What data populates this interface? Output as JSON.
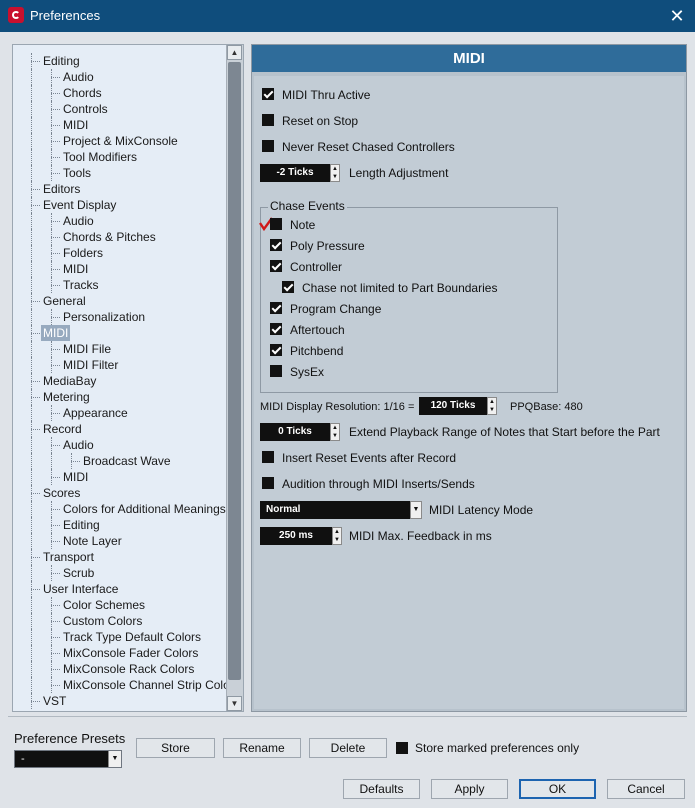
{
  "window": {
    "title": "Preferences",
    "close_glyph": "✕"
  },
  "tree": {
    "items": [
      {
        "label": "Editing",
        "level": 0
      },
      {
        "label": "Audio",
        "level": 1
      },
      {
        "label": "Chords",
        "level": 1
      },
      {
        "label": "Controls",
        "level": 1
      },
      {
        "label": "MIDI",
        "level": 1
      },
      {
        "label": "Project & MixConsole",
        "level": 1
      },
      {
        "label": "Tool Modifiers",
        "level": 1
      },
      {
        "label": "Tools",
        "level": 1
      },
      {
        "label": "Editors",
        "level": 0
      },
      {
        "label": "Event Display",
        "level": 0
      },
      {
        "label": "Audio",
        "level": 1
      },
      {
        "label": "Chords & Pitches",
        "level": 1
      },
      {
        "label": "Folders",
        "level": 1
      },
      {
        "label": "MIDI",
        "level": 1
      },
      {
        "label": "Tracks",
        "level": 1
      },
      {
        "label": "General",
        "level": 0
      },
      {
        "label": "Personalization",
        "level": 1
      },
      {
        "label": "MIDI",
        "level": 0,
        "selected": true
      },
      {
        "label": "MIDI File",
        "level": 1
      },
      {
        "label": "MIDI Filter",
        "level": 1
      },
      {
        "label": "MediaBay",
        "level": 0
      },
      {
        "label": "Metering",
        "level": 0
      },
      {
        "label": "Appearance",
        "level": 1
      },
      {
        "label": "Record",
        "level": 0
      },
      {
        "label": "Audio",
        "level": 1
      },
      {
        "label": "Broadcast Wave",
        "level": 2
      },
      {
        "label": "MIDI",
        "level": 1
      },
      {
        "label": "Scores",
        "level": 0
      },
      {
        "label": "Colors for Additional Meanings",
        "level": 1
      },
      {
        "label": "Editing",
        "level": 1
      },
      {
        "label": "Note Layer",
        "level": 1
      },
      {
        "label": "Transport",
        "level": 0
      },
      {
        "label": "Scrub",
        "level": 1
      },
      {
        "label": "User Interface",
        "level": 0
      },
      {
        "label": "Color Schemes",
        "level": 1
      },
      {
        "label": "Custom Colors",
        "level": 1
      },
      {
        "label": "Track Type Default Colors",
        "level": 1
      },
      {
        "label": "MixConsole Fader Colors",
        "level": 1
      },
      {
        "label": "MixConsole Rack Colors",
        "level": 1
      },
      {
        "label": "MixConsole Channel Strip Colors",
        "level": 1
      },
      {
        "label": "VST",
        "level": 0
      }
    ]
  },
  "main": {
    "header": "MIDI",
    "midi_thru_active": {
      "label": "MIDI Thru Active",
      "checked": true
    },
    "reset_on_stop": {
      "label": "Reset on Stop",
      "checked": false
    },
    "never_reset": {
      "label": "Never Reset Chased Controllers",
      "checked": false
    },
    "length_adjustment": {
      "value": "-2 Ticks",
      "label": "Length Adjustment"
    },
    "chase_events": {
      "title": "Chase Events",
      "note": {
        "label": "Note",
        "checked": false
      },
      "poly_pressure": {
        "label": "Poly Pressure",
        "checked": true
      },
      "controller": {
        "label": "Controller",
        "checked": true
      },
      "chase_not_limited": {
        "label": "Chase not limited to Part Boundaries",
        "checked": true
      },
      "program_change": {
        "label": "Program Change",
        "checked": true
      },
      "aftertouch": {
        "label": "Aftertouch",
        "checked": true
      },
      "pitchbend": {
        "label": "Pitchbend",
        "checked": true
      },
      "sysex": {
        "label": "SysEx",
        "checked": false
      }
    },
    "display_resolution": {
      "label": "MIDI Display Resolution: 1/16 =",
      "value": "120 Ticks",
      "ppq": "PPQBase: 480"
    },
    "extend_playback": {
      "value": "0 Ticks",
      "label": "Extend Playback Range of Notes that Start before the Part"
    },
    "insert_reset": {
      "label": "Insert Reset Events after Record",
      "checked": false
    },
    "audition": {
      "label": "Audition through MIDI Inserts/Sends",
      "checked": false
    },
    "latency_mode": {
      "value": "Normal",
      "label": "MIDI Latency Mode"
    },
    "max_feedback": {
      "value": "250 ms",
      "label": "MIDI Max. Feedback in ms"
    }
  },
  "bottom": {
    "presets_label": "Preference Presets",
    "preset_value": "-",
    "store": "Store",
    "rename": "Rename",
    "delete": "Delete",
    "store_marked": "Store marked preferences only",
    "defaults": "Defaults",
    "apply": "Apply",
    "ok": "OK",
    "cancel": "Cancel"
  },
  "colors": {
    "title_bar": "#0f4d7c",
    "header": "#2f6c9a",
    "selection": "#97aabf"
  }
}
